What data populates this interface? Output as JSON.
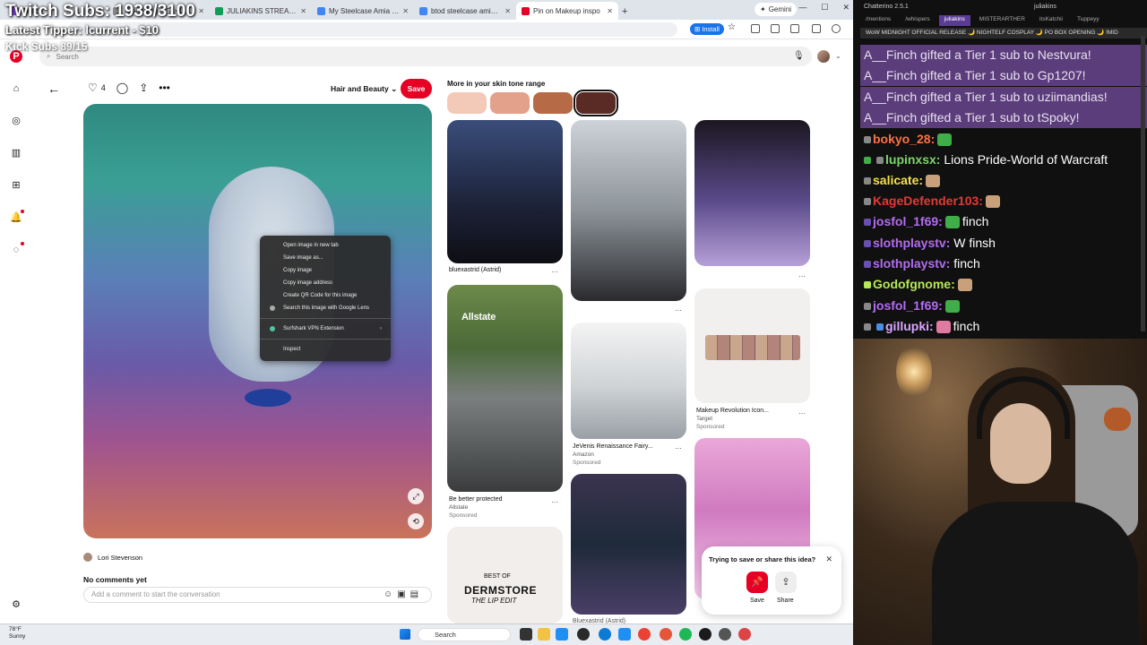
{
  "overlay": {
    "subs": "Twitch Subs: 1938/3100",
    "tipper": "Latest Tipper: lcurrent - $10",
    "kick": "Kick Subs 89/15"
  },
  "browser": {
    "tabs": [
      {
        "label": "Twitch",
        "color": "#9146ff"
      },
      {
        "label": "image.png (453×1191)",
        "color": "#888888"
      },
      {
        "label": "JULIAKINS STREAM SCHEDU...",
        "color": "#0f9d58"
      },
      {
        "label": "My Steelcase Amia Review 1...",
        "color": "#4285f4"
      },
      {
        "label": "btod steelcase amia - Google",
        "color": "#4285f4"
      },
      {
        "label": "Pin on Makeup inspo",
        "color": "#e60023",
        "active": true
      }
    ],
    "new_tab": "+",
    "gemini": "Gemini",
    "install": "Install"
  },
  "pinterest": {
    "search_placeholder": "Search",
    "like_count": "4",
    "board": "Hair and Beauty",
    "save": "Save",
    "context_menu": [
      "Open image in new tab",
      "Save image as...",
      "Copy image",
      "Copy image address",
      "Create QR Code for this image",
      "Search this image with Google Lens",
      "Surfshark VPN Extension",
      "Inspect"
    ],
    "author": "Lori Stevenson",
    "no_comments": "No comments yet",
    "comment_placeholder": "Add a comment to start the conversation",
    "skin_title": "More in your skin tone range",
    "swatches": [
      "#f3c9b8",
      "#e3a08a",
      "#b66a45",
      "#5a2a24"
    ],
    "feed": {
      "bluexastrid": "bluexastrid (Astrid)",
      "makeup_title": "Makeup Revolution Icon...",
      "makeup_store": "Target",
      "sponsored": "Sponsored",
      "allstate_title": "Be better protected",
      "allstate_store": "Allstate",
      "allstate_logo": "Allstate",
      "jevenis_title": "JeVenis Renaissance Fairy...",
      "jevenis_store": "Amazon",
      "dermstore_best": "BEST OF",
      "dermstore_brand": "DERMSTORE",
      "dermstore_edit": "THE LIP EDIT",
      "bottom_caption": "Bluexastrid (Astrid)"
    },
    "popup": {
      "title": "Trying to save or share this idea?",
      "save": "Save",
      "share": "Share"
    }
  },
  "taskbar": {
    "temp": "78°F",
    "weather": "Sunny",
    "search": "Search"
  },
  "chat": {
    "title": "Chatterino 2.5.1",
    "user": "juliakins",
    "tabs": [
      "/mentions",
      "/whispers",
      "juliakins",
      "MISTERARTHER",
      "itsKatchii",
      "Tuppeyy"
    ],
    "banner": "WoW MIDNIGHT OFFICIAL RELEASE 🌙 NIGHTELF COSPLAY 🌙 PO BOX OPENING 🌙 !MID",
    "gifts": [
      "A__Finch gifted a Tier 1 sub to Nestvura!",
      "A__Finch gifted a Tier 1 sub to Gp1207!",
      "A__Finch gifted a Tier 1 sub to uziimandias!",
      "A__Finch gifted a Tier 1 sub to tSpoky!"
    ],
    "messages": [
      {
        "name": "bokyo_28:",
        "color": "#ff7043",
        "text": ""
      },
      {
        "name": "lupinxsx:",
        "color": "#7cd66a",
        "text": "Lions Pride-World of Warcraft"
      },
      {
        "name": "salicate:",
        "color": "#f5e04a",
        "text": ""
      },
      {
        "name": "KageDefender103:",
        "color": "#e53935",
        "text": ""
      },
      {
        "name": "josfol_1f69:",
        "color": "#b36cf0",
        "text": "finch"
      },
      {
        "name": "slothplaystv:",
        "color": "#b36cf0",
        "text": "W finsh"
      },
      {
        "name": "slothplaystv:",
        "color": "#b36cf0",
        "text": "finch"
      },
      {
        "name": "Godofgnome:",
        "color": "#b5e853",
        "text": ""
      },
      {
        "name": "josfol_1f69:",
        "color": "#b36cf0",
        "text": ""
      },
      {
        "name": "gillupki:",
        "color": "#d9a6ff",
        "text": "finch"
      }
    ]
  }
}
